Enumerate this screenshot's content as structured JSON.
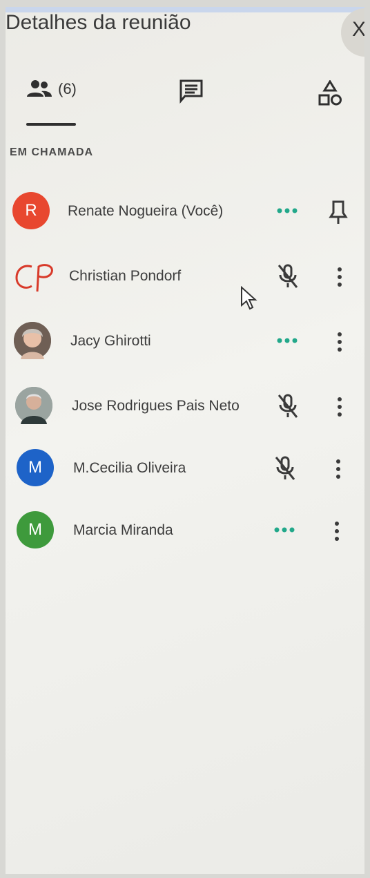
{
  "header": {
    "title": "Detalhes da reunião",
    "close_label": "X"
  },
  "tabs": {
    "people_count": "(6)"
  },
  "section": {
    "label": "EM CHAMADA"
  },
  "participants": [
    {
      "name": "Renate Nogueira (Você)",
      "avatar_letter": "R",
      "avatar_color": "#e8472f",
      "status": "speaking-dots"
    },
    {
      "name": "Christian Pondorf",
      "avatar_letter": "",
      "avatar_color": "",
      "status": "muted"
    },
    {
      "name": "Jacy Ghirotti",
      "avatar_letter": "",
      "avatar_color": "#8a7a70",
      "status": "speaking-dots"
    },
    {
      "name": "Jose Rodrigues Pais Neto",
      "avatar_letter": "",
      "avatar_color": "#7f8a86",
      "status": "muted"
    },
    {
      "name": "M.Cecilia Oliveira",
      "avatar_letter": "M",
      "avatar_color": "#1e63c8",
      "status": "muted"
    },
    {
      "name": "Marcia Miranda",
      "avatar_letter": "M",
      "avatar_color": "#3e9a3c",
      "status": "speaking-dots"
    }
  ],
  "colors": {
    "accent_teal": "#22a88a",
    "icon_dark": "#3a3a3a"
  }
}
